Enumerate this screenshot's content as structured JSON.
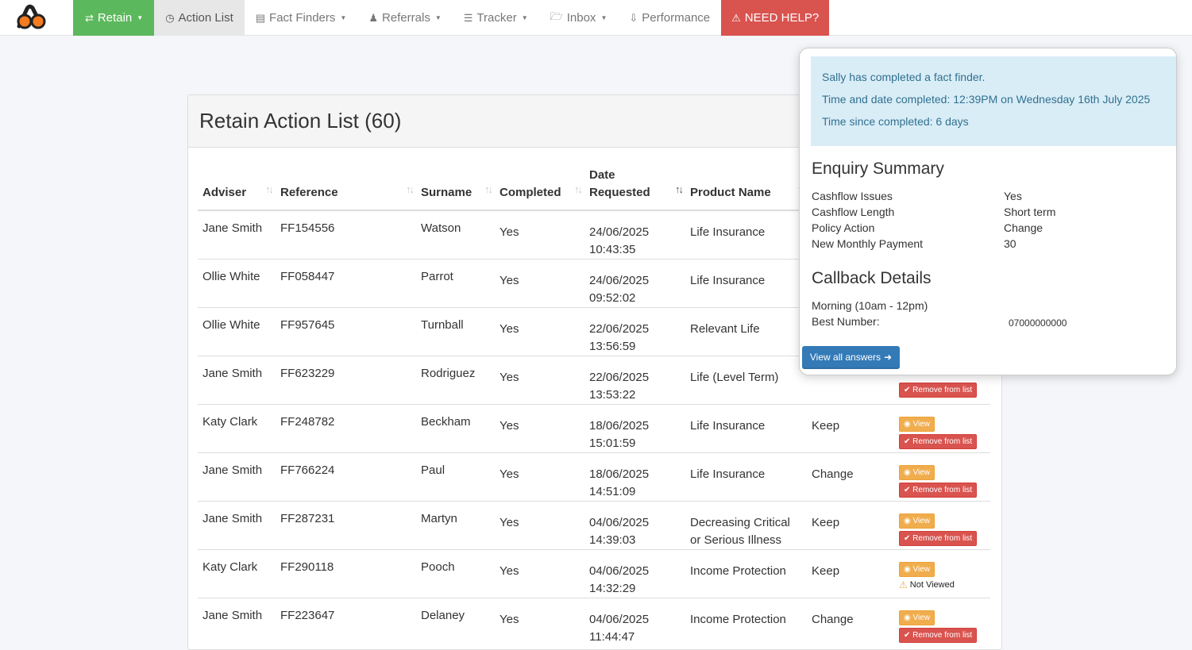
{
  "nav": {
    "retain": "Retain",
    "action_list": "Action List",
    "fact_finders": "Fact Finders",
    "referrals": "Referrals",
    "tracker": "Tracker",
    "inbox": "Inbox",
    "performance": "Performance",
    "help": "NEED HELP?"
  },
  "panel": {
    "title": "Retain Action List (60)"
  },
  "table": {
    "headers": {
      "adviser": "Adviser",
      "reference": "Reference",
      "surname": "Surname",
      "completed": "Completed",
      "date_requested_1": "Date",
      "date_requested_2": "Requested",
      "product_name": "Product Name"
    },
    "rows": [
      {
        "adviser": "Jane Smith",
        "reference": "FF154556",
        "surname": "Watson",
        "completed": "Yes",
        "date": "24/06/2025",
        "time": "10:43:35",
        "product1": "Life Insurance",
        "product2": "",
        "action": ""
      },
      {
        "adviser": "Ollie White",
        "reference": "FF058447",
        "surname": "Parrot",
        "completed": "Yes",
        "date": "24/06/2025",
        "time": "09:52:02",
        "product1": "Life Insurance",
        "product2": "",
        "action": ""
      },
      {
        "adviser": "Ollie White",
        "reference": "FF957645",
        "surname": "Turnball",
        "completed": "Yes",
        "date": "22/06/2025",
        "time": "13:56:59",
        "product1": "Relevant Life",
        "product2": "",
        "action": ""
      },
      {
        "adviser": "Jane Smith",
        "reference": "FF623229",
        "surname": "Rodriguez",
        "completed": "Yes",
        "date": "22/06/2025",
        "time": "13:53:22",
        "product1": "Life (Level Term)",
        "product2": "",
        "action": ""
      },
      {
        "adviser": "Katy Clark",
        "reference": "FF248782",
        "surname": "Beckham",
        "completed": "Yes",
        "date": "18/06/2025",
        "time": "15:01:59",
        "product1": "Life Insurance",
        "product2": "",
        "action": "Keep"
      },
      {
        "adviser": "Jane Smith",
        "reference": "FF766224",
        "surname": "Paul",
        "completed": "Yes",
        "date": "18/06/2025",
        "time": "14:51:09",
        "product1": "Life Insurance",
        "product2": "",
        "action": "Change"
      },
      {
        "adviser": "Jane Smith",
        "reference": "FF287231",
        "surname": "Martyn",
        "completed": "Yes",
        "date": "04/06/2025",
        "time": "14:39:03",
        "product1": "Decreasing Critical",
        "product2": "or Serious Illness",
        "action": "Keep"
      },
      {
        "adviser": "Katy Clark",
        "reference": "FF290118",
        "surname": "Pooch",
        "completed": "Yes",
        "date": "04/06/2025",
        "time": "14:32:29",
        "product1": "Income Protection",
        "product2": "",
        "action": "Keep"
      },
      {
        "adviser": "Jane Smith",
        "reference": "FF223647",
        "surname": "Delaney",
        "completed": "Yes",
        "date": "04/06/2025",
        "time": "11:44:47",
        "product1": "Income Protection",
        "product2": "",
        "action": "Change"
      }
    ],
    "view_label": "View",
    "remove_label": "Remove from list",
    "not_viewed_label": "Not Viewed"
  },
  "popover": {
    "alert_line1": "Sally has completed a fact finder.",
    "alert_line2": "Time and date completed: 12:39PM on Wednesday 16th July 2025",
    "alert_line3": "Time since completed: 6 days",
    "enquiry_title": "Enquiry Summary",
    "enquiry": [
      {
        "key": "Cashflow Issues",
        "value": "Yes"
      },
      {
        "key": "Cashflow Length",
        "value": "Short term"
      },
      {
        "key": "Policy Action",
        "value": "Change"
      },
      {
        "key": "New Monthly Payment",
        "value": "30"
      }
    ],
    "callback_title": "Callback Details",
    "callback_time": "Morning (10am - 12pm)",
    "best_number_label": "Best Number:",
    "best_number": "07000000000",
    "view_all": "View all answers"
  },
  "colors": {
    "retain_green": "#5cb85c",
    "help_red": "#d9534f",
    "view_orange": "#f0ad4e",
    "primary_blue": "#337ab7",
    "info_bg": "#d9edf7"
  }
}
